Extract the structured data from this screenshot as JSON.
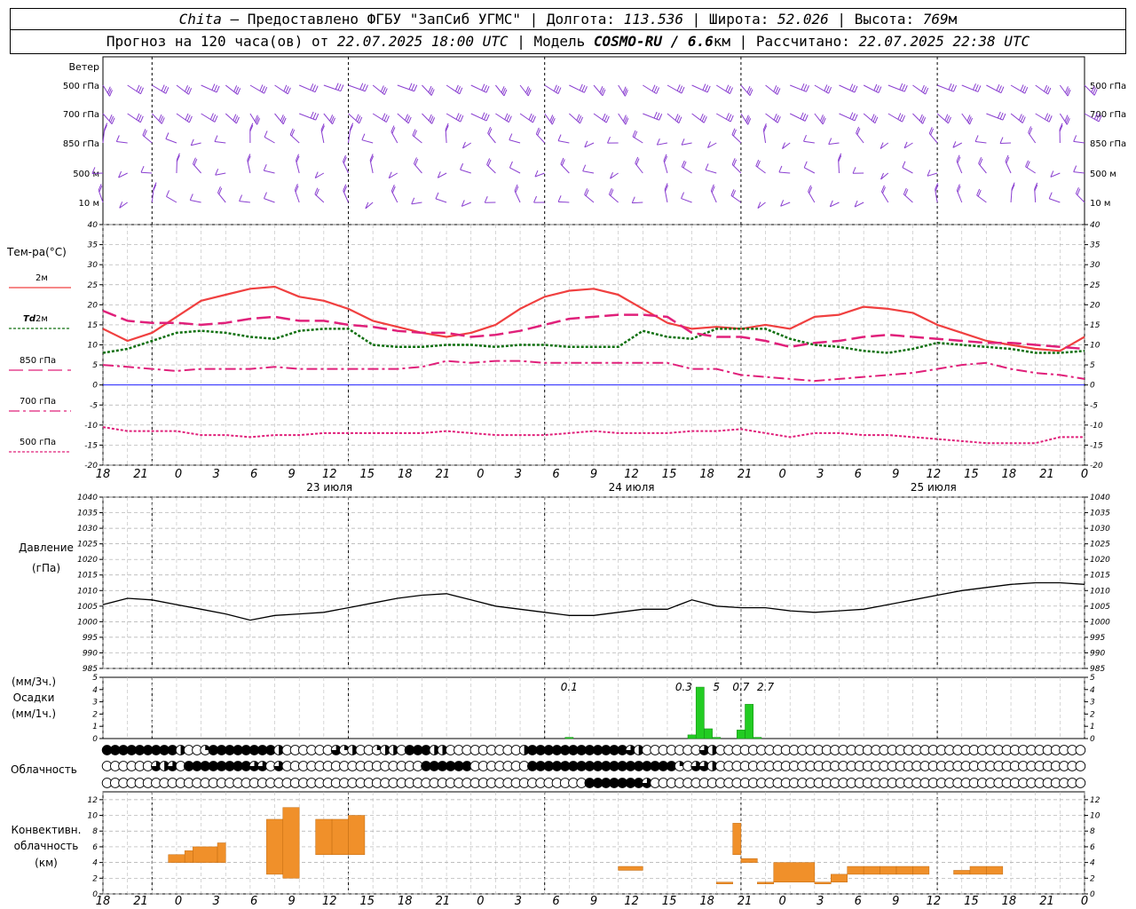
{
  "header": {
    "station": "Chita",
    "provider": " – Предоставлено ФГБУ \"ЗапСиб УГМС\" | Долгота: ",
    "lon": "113.536",
    "lat_label": " | Широта: ",
    "lat": "52.026",
    "alt_label": " | Высота: ",
    "alt": "769",
    "alt_unit": "м",
    "forecast_label": "Прогноз на 120 часа(ов) от ",
    "forecast_time": "22.07.2025 18:00 UTC",
    "model_label": "  | Модель ",
    "model": "COSMO-RU / 6.6",
    "model_unit": "км",
    "calc_label": " | Рассчитано: ",
    "calc_time": "22.07.2025 22:38 UTC"
  },
  "colors": {
    "t2m": "#f04040",
    "td2m": "#107010",
    "t850": "#e0207a",
    "t700": "#e0207a",
    "t500": "#e0207a",
    "wind": "#8a3fd0",
    "precip": "#22cc22",
    "conv": "#f0902a",
    "pressure": "#000000",
    "zero_line": "#2020ff"
  },
  "chart_data": [
    {
      "type": "scatter",
      "title": "Ветер",
      "levels": [
        "500 гПа",
        "700 гПа",
        "850 гПа",
        "500 м",
        "10 м"
      ],
      "note": "wind barbs, every 3 h, length ~ speed"
    },
    {
      "type": "line",
      "title": "Тем-ра(°C)",
      "ylim": [
        -20,
        40
      ],
      "yticks": [
        -20,
        -15,
        -10,
        -5,
        0,
        5,
        10,
        15,
        20,
        25,
        30,
        35,
        40
      ],
      "x_hours": [
        0,
        3,
        6,
        9,
        12,
        15,
        18,
        21,
        24,
        27,
        30,
        33,
        36,
        39,
        42,
        45,
        48,
        51,
        54,
        57,
        60,
        63,
        66,
        69,
        72,
        75,
        78,
        81,
        84,
        87,
        90,
        93,
        96,
        99,
        102,
        105,
        108,
        111,
        114,
        117,
        120
      ],
      "series": [
        {
          "name": "2м",
          "key": "t2m",
          "values": [
            14,
            11,
            13,
            17,
            21,
            22.5,
            24,
            24.5,
            22,
            21,
            19,
            16,
            14.5,
            13,
            12,
            13,
            15,
            19,
            22,
            23.5,
            24,
            22.5,
            19,
            15.5,
            14,
            14.5,
            14,
            15,
            14,
            17,
            17.5,
            19.5,
            19,
            18,
            15,
            13,
            11,
            10,
            9,
            8.5,
            12
          ]
        },
        {
          "name": "Td 2м",
          "key": "td2m",
          "values": [
            8,
            9,
            11,
            13,
            13.5,
            13,
            12,
            11.5,
            13.5,
            14,
            14,
            10,
            9.5,
            9.5,
            10,
            10,
            9.5,
            10,
            10,
            9.5,
            9.5,
            9.5,
            13.5,
            12,
            11.5,
            14,
            14,
            14,
            11.5,
            10,
            9.5,
            8.5,
            8,
            9,
            10.5,
            10,
            9.5,
            9,
            8,
            8,
            8.5
          ]
        },
        {
          "name": "850 гПа",
          "key": "t850",
          "values": [
            18.5,
            16,
            15.5,
            15.5,
            15,
            15.5,
            16.5,
            17,
            16,
            16,
            15,
            14.5,
            13.5,
            13,
            13,
            12,
            12.5,
            13.5,
            15,
            16.5,
            17,
            17.5,
            17.5,
            17,
            13,
            12,
            12,
            11,
            9.5,
            10.5,
            11,
            12,
            12.5,
            12,
            11.5,
            11,
            10.5,
            10.5,
            10,
            9.5,
            9
          ]
        },
        {
          "name": "700 гПа",
          "key": "t700",
          "values": [
            5,
            4.5,
            4,
            3.5,
            4,
            4,
            4,
            4.5,
            4,
            4,
            4,
            4,
            4,
            4.5,
            6,
            5.5,
            6,
            6,
            5.5,
            5.5,
            5.5,
            5.5,
            5.5,
            5.5,
            4,
            4,
            2.5,
            2,
            1.5,
            1,
            1.5,
            2,
            2.5,
            3,
            4,
            5,
            5.5,
            4,
            3,
            2.5,
            1.5
          ]
        },
        {
          "name": "500 гПа",
          "key": "t500",
          "values": [
            -10.5,
            -11.5,
            -11.5,
            -11.5,
            -12.5,
            -12.5,
            -13,
            -12.5,
            -12.5,
            -12,
            -12,
            -12,
            -12,
            -12,
            -11.5,
            -12,
            -12.5,
            -12.5,
            -12.5,
            -12,
            -11.5,
            -12,
            -12,
            -12,
            -11.5,
            -11.5,
            -11,
            -12,
            -13,
            -12,
            -12,
            -12.5,
            -12.5,
            -13,
            -13.5,
            -14,
            -14.5,
            -14.5,
            -14.5,
            -13,
            -13
          ]
        }
      ]
    },
    {
      "type": "line",
      "title": "Давление",
      "ylabel": "(гПа)",
      "ylim": [
        985,
        1040
      ],
      "yticks": [
        985,
        990,
        995,
        1000,
        1005,
        1010,
        1015,
        1020,
        1025,
        1030,
        1035,
        1040
      ],
      "x_hours": [
        0,
        3,
        6,
        9,
        12,
        15,
        18,
        21,
        24,
        27,
        30,
        33,
        36,
        39,
        42,
        45,
        48,
        51,
        54,
        57,
        60,
        63,
        66,
        69,
        72,
        75,
        78,
        81,
        84,
        87,
        90,
        93,
        96,
        99,
        102,
        105,
        108,
        111,
        114,
        117,
        120
      ],
      "values": [
        1005.5,
        1007.5,
        1007,
        1005.5,
        1004,
        1002.5,
        1000.5,
        1002,
        1002.5,
        1003,
        1004.5,
        1006,
        1007.5,
        1008.5,
        1009,
        1007,
        1005,
        1004,
        1003,
        1002,
        1002,
        1003,
        1004,
        1004,
        1007,
        1005,
        1004.5,
        1004.5,
        1003.5,
        1003,
        1003.5,
        1004,
        1005.5,
        1007,
        1008.5,
        1010,
        1011,
        1012,
        1012.5,
        1012.5,
        1012
      ]
    },
    {
      "type": "bar",
      "title": "Осадки",
      "ylabel": "(мм/3ч.)",
      "ylabel2": "(мм/1ч.)",
      "ylim": [
        0,
        5
      ],
      "yticks": [
        0,
        1,
        2,
        3,
        4,
        5
      ],
      "bars": [
        {
          "h": 57,
          "v": 0.1
        },
        {
          "h": 72,
          "v": 0.3
        },
        {
          "h": 73,
          "v": 4.2
        },
        {
          "h": 74,
          "v": 0.8
        },
        {
          "h": 75,
          "v": 0.1
        },
        {
          "h": 78,
          "v": 0.7
        },
        {
          "h": 79,
          "v": 2.8
        },
        {
          "h": 80,
          "v": 0.1
        }
      ],
      "labels": [
        {
          "h": 57,
          "text": "0.1"
        },
        {
          "h": 71,
          "text": "0.3"
        },
        {
          "h": 75,
          "text": "5"
        },
        {
          "h": 78,
          "text": "0.7"
        },
        {
          "h": 81,
          "text": "2.7"
        }
      ]
    },
    {
      "type": "table",
      "title": "Облачность",
      "note": "cloud cover symbols per hour, 3 rows: high, middle, low; 0 empty, 1 quarter, 2 half, 3 three-quarter, 4 full",
      "rows": [
        [
          4,
          4,
          4,
          4,
          4,
          4,
          4,
          4,
          4,
          2,
          0,
          0,
          1,
          4,
          4,
          4,
          4,
          4,
          4,
          4,
          4,
          2,
          0,
          0,
          0,
          0,
          0,
          0,
          3,
          1,
          2,
          0,
          0,
          1,
          2,
          2,
          0,
          4,
          4,
          4,
          2,
          2,
          0,
          0,
          0,
          0,
          0,
          0,
          0,
          0,
          0,
          2,
          4,
          4,
          4,
          4,
          4,
          4,
          4,
          4,
          4,
          4,
          4,
          4,
          3,
          2,
          0,
          0,
          0,
          0,
          0,
          0,
          0,
          3,
          2,
          0,
          0,
          0,
          0,
          0,
          0,
          0,
          0,
          0,
          0,
          0,
          0,
          0,
          0,
          0,
          0,
          0,
          0,
          0,
          0,
          0,
          0,
          0,
          0,
          0,
          0,
          0,
          0,
          0,
          0,
          0,
          0,
          0,
          0,
          0,
          0,
          0,
          0,
          0,
          0,
          0,
          0,
          0,
          0,
          0,
          0,
          0
        ],
        [
          0,
          0,
          0,
          0,
          0,
          0,
          3,
          2,
          3,
          0,
          4,
          4,
          4,
          4,
          4,
          4,
          4,
          4,
          3,
          3,
          0,
          3,
          0,
          0,
          0,
          0,
          0,
          0,
          0,
          0,
          0,
          0,
          0,
          0,
          0,
          0,
          0,
          0,
          0,
          4,
          4,
          4,
          4,
          4,
          4,
          0,
          0,
          0,
          0,
          0,
          0,
          0,
          4,
          4,
          4,
          4,
          4,
          4,
          4,
          4,
          4,
          4,
          4,
          4,
          4,
          4,
          4,
          4,
          4,
          4,
          1,
          0,
          3,
          3,
          2,
          0,
          0,
          0,
          0,
          0,
          0,
          0,
          0,
          0,
          0,
          0,
          0,
          0,
          0,
          0,
          0,
          0,
          0,
          0,
          0,
          0,
          0,
          0,
          0,
          0,
          0,
          0,
          0,
          0,
          0,
          0,
          0,
          0,
          0,
          0,
          0,
          0,
          0,
          0,
          0,
          0,
          0,
          0,
          0,
          0,
          0,
          0
        ],
        [
          0,
          0,
          0,
          0,
          0,
          0,
          0,
          0,
          0,
          0,
          0,
          0,
          0,
          0,
          0,
          0,
          0,
          0,
          0,
          0,
          0,
          0,
          0,
          0,
          0,
          0,
          0,
          0,
          0,
          0,
          0,
          0,
          0,
          0,
          0,
          0,
          0,
          0,
          0,
          0,
          0,
          0,
          0,
          0,
          0,
          0,
          0,
          0,
          0,
          0,
          0,
          0,
          0,
          0,
          0,
          0,
          0,
          0,
          0,
          4,
          4,
          4,
          4,
          4,
          4,
          4,
          3,
          0,
          0,
          0,
          0,
          0,
          0,
          0,
          0,
          0,
          0,
          0,
          0,
          0,
          0,
          0,
          0,
          0,
          0,
          0,
          0,
          0,
          0,
          0,
          0,
          0,
          0,
          0,
          0,
          0,
          0,
          0,
          0,
          0,
          0,
          0,
          0,
          0,
          0,
          0,
          0,
          0,
          0,
          0,
          0,
          0,
          0,
          0,
          0,
          0,
          0,
          0,
          0,
          0,
          0,
          0
        ]
      ]
    },
    {
      "type": "bar",
      "title": "Конвективн.",
      "ylabel": "облачность",
      "ylabel2": "(км)",
      "ylim": [
        0,
        13
      ],
      "yticks": [
        0,
        2,
        4,
        6,
        8,
        10,
        12
      ],
      "bars": [
        {
          "h0": 8,
          "h1": 10,
          "base": 4,
          "top": 5
        },
        {
          "h0": 10,
          "h1": 11,
          "base": 4,
          "top": 5.5
        },
        {
          "h0": 11,
          "h1": 14,
          "base": 4,
          "top": 6
        },
        {
          "h0": 14,
          "h1": 15,
          "base": 4,
          "top": 6.5
        },
        {
          "h0": 20,
          "h1": 22,
          "base": 2.5,
          "top": 9.5
        },
        {
          "h0": 22,
          "h1": 24,
          "base": 2,
          "top": 11
        },
        {
          "h0": 26,
          "h1": 28,
          "base": 5,
          "top": 9.5
        },
        {
          "h0": 28,
          "h1": 30,
          "base": 5,
          "top": 9.5
        },
        {
          "h0": 30,
          "h1": 32,
          "base": 5,
          "top": 10
        },
        {
          "h0": 63,
          "h1": 66,
          "base": 3,
          "top": 3.5
        },
        {
          "h0": 75,
          "h1": 77,
          "base": 1.5,
          "top": 1.5
        },
        {
          "h0": 77,
          "h1": 78,
          "base": 5,
          "top": 9
        },
        {
          "h0": 78,
          "h1": 80,
          "base": 4,
          "top": 4.5
        },
        {
          "h0": 80,
          "h1": 81,
          "base": 1.5,
          "top": 1.5
        },
        {
          "h0": 81,
          "h1": 82,
          "base": 1.5,
          "top": 1.5
        },
        {
          "h0": 82,
          "h1": 87,
          "base": 1.5,
          "top": 4
        },
        {
          "h0": 87,
          "h1": 89,
          "base": 1.5,
          "top": 1.5
        },
        {
          "h0": 89,
          "h1": 91,
          "base": 1.5,
          "top": 2.5
        },
        {
          "h0": 91,
          "h1": 93,
          "base": 2.5,
          "top": 3.5
        },
        {
          "h0": 93,
          "h1": 95,
          "base": 2.5,
          "top": 3.5
        },
        {
          "h0": 95,
          "h1": 97,
          "base": 2.5,
          "top": 3.5
        },
        {
          "h0": 97,
          "h1": 99,
          "base": 2.5,
          "top": 3.5
        },
        {
          "h0": 99,
          "h1": 101,
          "base": 2.5,
          "top": 3.5
        },
        {
          "h0": 104,
          "h1": 106,
          "base": 2.5,
          "top": 3
        },
        {
          "h0": 106,
          "h1": 108,
          "base": 2.5,
          "top": 3.5
        },
        {
          "h0": 108,
          "h1": 110,
          "base": 2.5,
          "top": 3.5
        }
      ]
    }
  ],
  "time_axis": {
    "tick_labels": [
      "18",
      "21",
      "0",
      "3",
      "6",
      "9",
      "12",
      "15",
      "18",
      "21",
      "0",
      "3",
      "6",
      "9",
      "12",
      "15",
      "18",
      "21",
      "0",
      "3",
      "6",
      "9",
      "12",
      "15",
      "18",
      "21",
      "0"
    ],
    "day_labels": [
      "23 июля",
      "24 июля",
      "25 июля"
    ]
  },
  "legend": {
    "t2m": "2м",
    "td2m_a": "Td",
    "td2m_b": " 2м",
    "t850": "850 гПа",
    "t700": "700 гПа",
    "t500": "500 гПа"
  }
}
